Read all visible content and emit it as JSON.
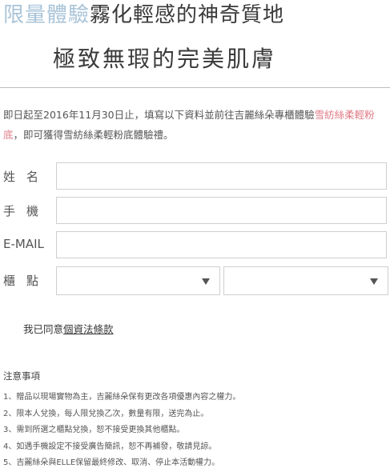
{
  "headline": {
    "line1_highlight": "限量體驗",
    "line1_rest": "霧化輕感的神奇質地",
    "line2": "極致無瑕的完美肌膚"
  },
  "intro": {
    "part1": "即日起至2016年11月30日止，填寫以下資料並前往吉麗絲朵專櫃體驗",
    "product": "雪紡絲柔輕粉底",
    "part2": "，即可獲得雪紡絲柔輕粉底體驗禮。"
  },
  "form": {
    "name_label": "姓名",
    "name_value": "",
    "phone_label": "手機",
    "phone_value": "",
    "email_label": "E-MAIL",
    "email_value": "",
    "counter_label": "櫃點",
    "counter_select_1": "",
    "counter_select_2": ""
  },
  "agree": {
    "prefix": "我已同意",
    "link": "個資法條款"
  },
  "notes": {
    "title": "注意事項",
    "items": [
      "1、贈品以現場實物為主，吉麗絲朵保有更改各項優惠內容之權力。",
      "2、限本人兌換，每人限兌換乙次，數量有限，送完為止。",
      "3、需到所選之櫃點兌換，恕不接受更換其他櫃點。",
      "4、如遇手機設定不接受廣告簡訊，恕不再補發，敬請見諒。",
      "5、吉麗絲朵與ELLE保留最終修改、取消、停止本活動權力。"
    ]
  },
  "colors": {
    "accent_blue": "#a9c4d8",
    "accent_pink": "#e07b86"
  }
}
